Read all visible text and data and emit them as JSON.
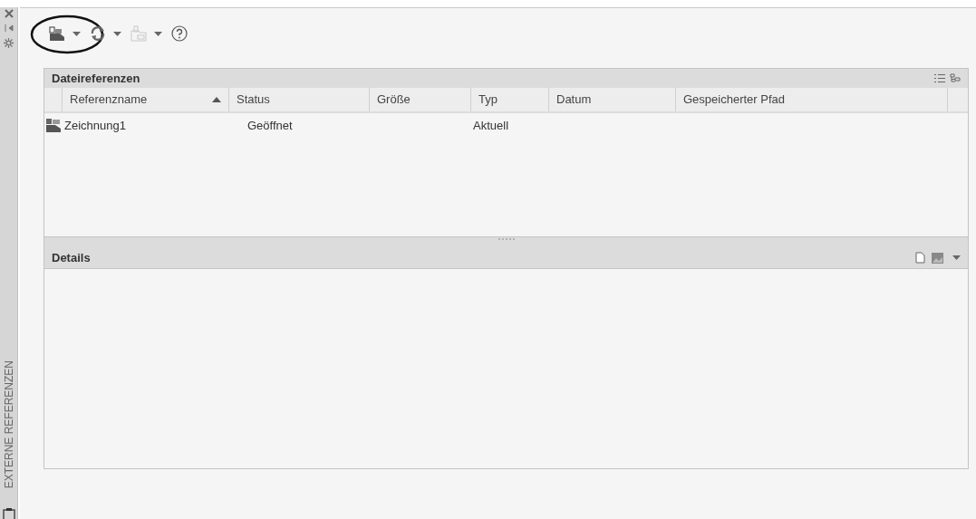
{
  "side_panel": {
    "title": "EXTERNE REFERENZEN"
  },
  "toolbar": {
    "items": [
      {
        "kind": "attach",
        "dropdown": true,
        "disabled": false,
        "highlighted": true
      },
      {
        "kind": "refresh",
        "dropdown": true,
        "disabled": false,
        "highlighted": false
      },
      {
        "kind": "change_path",
        "dropdown": true,
        "disabled": true,
        "highlighted": false
      },
      {
        "kind": "help",
        "dropdown": false,
        "disabled": false,
        "highlighted": false
      }
    ]
  },
  "file_references": {
    "title": "Dateireferenzen",
    "columns": [
      {
        "label": "Referenzname",
        "sorted": true
      },
      {
        "label": "Status",
        "sorted": false
      },
      {
        "label": "Größe",
        "sorted": false
      },
      {
        "label": "Typ",
        "sorted": false
      },
      {
        "label": "Datum",
        "sorted": false
      },
      {
        "label": "Gespeicherter Pfad",
        "sorted": false
      }
    ],
    "rows": [
      {
        "cells": [
          "Zeichnung1",
          "Geöffnet",
          "",
          "Aktuell",
          "",
          ""
        ]
      }
    ]
  },
  "details": {
    "title": "Details"
  }
}
